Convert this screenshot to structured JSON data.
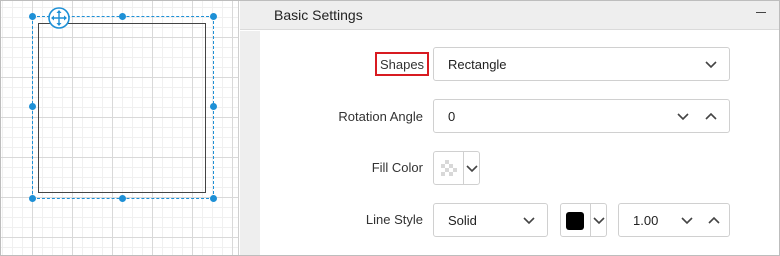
{
  "panel": {
    "title": "Basic Settings",
    "collapse_icon": "minus-icon"
  },
  "form": {
    "shapes_label": "Shapes",
    "shapes_value": "Rectangle",
    "rotation_label": "Rotation Angle",
    "rotation_value": "0",
    "fill_label": "Fill Color",
    "line_style_label": "Line Style",
    "line_style_value": "Solid",
    "line_color": "#000000",
    "line_width_value": "1.00"
  },
  "colors": {
    "accent": "#1e90d6",
    "highlight_border": "#d81b21"
  }
}
